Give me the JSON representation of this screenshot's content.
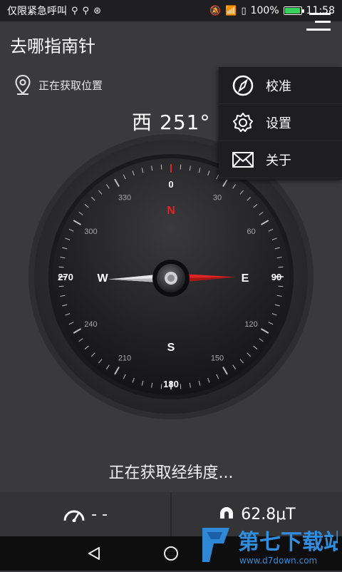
{
  "statusbar": {
    "notification": "仅限紧急呼叫",
    "battery": "100%",
    "time": "11:58"
  },
  "app": {
    "title": "去哪指南针"
  },
  "location": {
    "text": "正在获取位置"
  },
  "heading": {
    "direction": "西",
    "degrees": "251°"
  },
  "menu": {
    "items": [
      {
        "label": "校准",
        "icon": "compass-icon"
      },
      {
        "label": "设置",
        "icon": "gear-icon"
      },
      {
        "label": "关于",
        "icon": "mail-icon"
      }
    ]
  },
  "compass": {
    "heading_value": 251,
    "cardinals": {
      "n": "N",
      "e": "E",
      "s": "S",
      "w": "W"
    },
    "labels": [
      "0",
      "30",
      "60",
      "90",
      "120",
      "150",
      "180",
      "210",
      "240",
      "270",
      "300",
      "330"
    ]
  },
  "status": {
    "text": "正在获取经纬度..."
  },
  "bottom": {
    "speed": "- -",
    "magnetic": "62.8μT"
  },
  "watermark": {
    "text": "第七下载站",
    "url": "www.d7down.com"
  }
}
